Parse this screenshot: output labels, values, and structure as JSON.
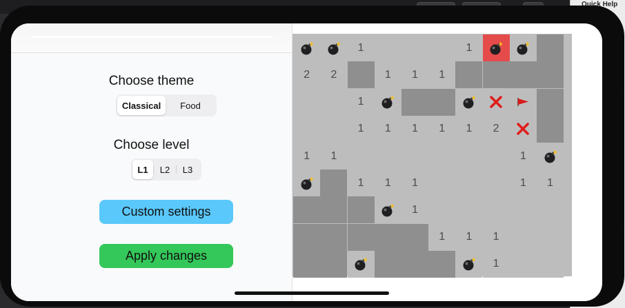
{
  "app": {
    "side_panel": {
      "theme_title": "Choose theme",
      "theme_options": [
        "Classical",
        "Food"
      ],
      "theme_selected": 0,
      "level_title": "Choose level",
      "level_options": [
        "L1",
        "L2",
        "L3"
      ],
      "level_selected": 0,
      "custom_button": "Custom settings",
      "apply_button": "Apply changes"
    },
    "quick_help": {
      "title": "Quick Help"
    },
    "colors": {
      "custom_button": "#5ac8fa",
      "apply_button": "#34c759",
      "hidden_cell": "#8f8f8f",
      "revealed_cell": "#bdbdbd",
      "exploded_cell": "#e64b4b"
    },
    "icons": {
      "mine": "bomb-icon",
      "flag": "flag-icon",
      "wrong": "cross-icon"
    }
  },
  "board": {
    "rows": 9,
    "cols": 10,
    "cells": [
      [
        "M",
        "M",
        "1",
        "",
        "",
        "",
        "1",
        "MX",
        "M",
        "H"
      ],
      [
        "2",
        "2",
        "H",
        "1",
        "1",
        "1",
        "H",
        "H",
        "H",
        "H"
      ],
      [
        "",
        "",
        "1",
        "M",
        "H",
        "H",
        "M",
        "X",
        "F",
        "H"
      ],
      [
        "",
        "",
        "1",
        "1",
        "1",
        "1",
        "1",
        "2",
        "X",
        "H"
      ],
      [
        "1",
        "1",
        "",
        "",
        "",
        "",
        "",
        "",
        "1",
        "M"
      ],
      [
        "M",
        "H",
        "1",
        "1",
        "1",
        "",
        "",
        "",
        "1",
        "1"
      ],
      [
        "H",
        "H",
        "H",
        "M",
        "1",
        "",
        "",
        "",
        "",
        ""
      ],
      [
        "H",
        "H",
        "H",
        "H",
        "H",
        "1",
        "1",
        "1",
        "",
        ""
      ],
      [
        "H",
        "H",
        "M",
        "H",
        "H",
        "H",
        "M",
        "1",
        "",
        ""
      ]
    ]
  }
}
